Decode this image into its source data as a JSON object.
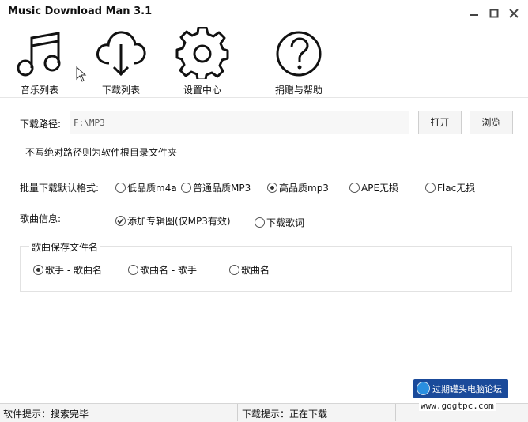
{
  "window": {
    "title": "Music Download Man 3.1"
  },
  "toolbar": {
    "items": [
      {
        "label": "音乐列表",
        "icon": "music-note-icon"
      },
      {
        "label": "下载列表",
        "icon": "cloud-download-icon"
      },
      {
        "label": "设置中心",
        "icon": "gear-icon"
      },
      {
        "label": "捐赠与帮助",
        "icon": "question-icon"
      }
    ]
  },
  "settings": {
    "download_path_label": "下载路径:",
    "download_path_value": "F:\\MP3",
    "open_button": "打开",
    "browse_button": "浏览",
    "path_hint": "不写绝对路径则为软件根目录文件夹",
    "format_label": "批量下载默认格式:",
    "formats": [
      {
        "label": "低品质m4a",
        "selected": false
      },
      {
        "label": "普通品质MP3",
        "selected": false
      },
      {
        "label": "高品质mp3",
        "selected": true
      },
      {
        "label": "APE无损",
        "selected": false
      },
      {
        "label": "Flac无损",
        "selected": false
      }
    ],
    "song_info_label": "歌曲信息:",
    "add_cover_label": "添加专辑图(仅MP3有效)",
    "add_cover_checked": true,
    "download_lyrics_label": "下载歌词",
    "download_lyrics_checked": false,
    "filename_group_label": "歌曲保存文件名",
    "filename_options": [
      {
        "label": "歌手 - 歌曲名",
        "selected": true
      },
      {
        "label": "歌曲名 - 歌手",
        "selected": false
      },
      {
        "label": "歌曲名",
        "selected": false
      }
    ]
  },
  "status": {
    "software_hint": "软件提示：搜索完毕",
    "download_hint": "下载提示：正在下载"
  },
  "watermark": {
    "text": "过期罐头电脑论坛",
    "url": "www.gqgtpc.com"
  }
}
